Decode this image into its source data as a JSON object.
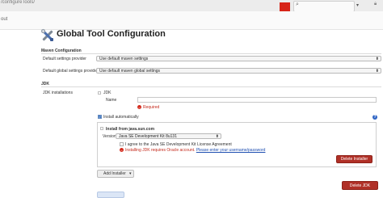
{
  "browser": {
    "url_fragment": "/configureTools/",
    "sub_fragment": "out"
  },
  "page": {
    "title": "Global Tool Configuration"
  },
  "maven": {
    "section": "Maven Configuration",
    "settings_label": "Default settings provider",
    "settings_value": "Use default maven settings",
    "global_label": "Default global settings provider",
    "global_value": "Use default maven global settings"
  },
  "jdk": {
    "section": "JDK",
    "installations_label": "JDK installations",
    "jdk_label": "JDK",
    "name_label": "Name",
    "required_text": "Required",
    "install_auto_label": "Install automatically",
    "installer_title": "Install from java.sun.com",
    "version_label": "Version",
    "version_value": "Java SE Development Kit 8u131",
    "license_label": "I agree to the Java SE Development Kit License Agreement",
    "oracle_error": "Installing JDK requires Oracle account.",
    "oracle_link": "Please enter your username/password",
    "delete_installer_label": "Delete Installer",
    "add_installer_label": "Add Installer",
    "delete_jdk_label": "Delete JDK"
  },
  "colors": {
    "danger": "#b03027",
    "error_text": "#c4291b",
    "link": "#1f4fb1",
    "checkbox": "#3b73c2"
  },
  "icons": {
    "tools": "tools-icon",
    "help": "help-icon",
    "error": "error-icon",
    "dropdown": "chevron-down-icon"
  }
}
